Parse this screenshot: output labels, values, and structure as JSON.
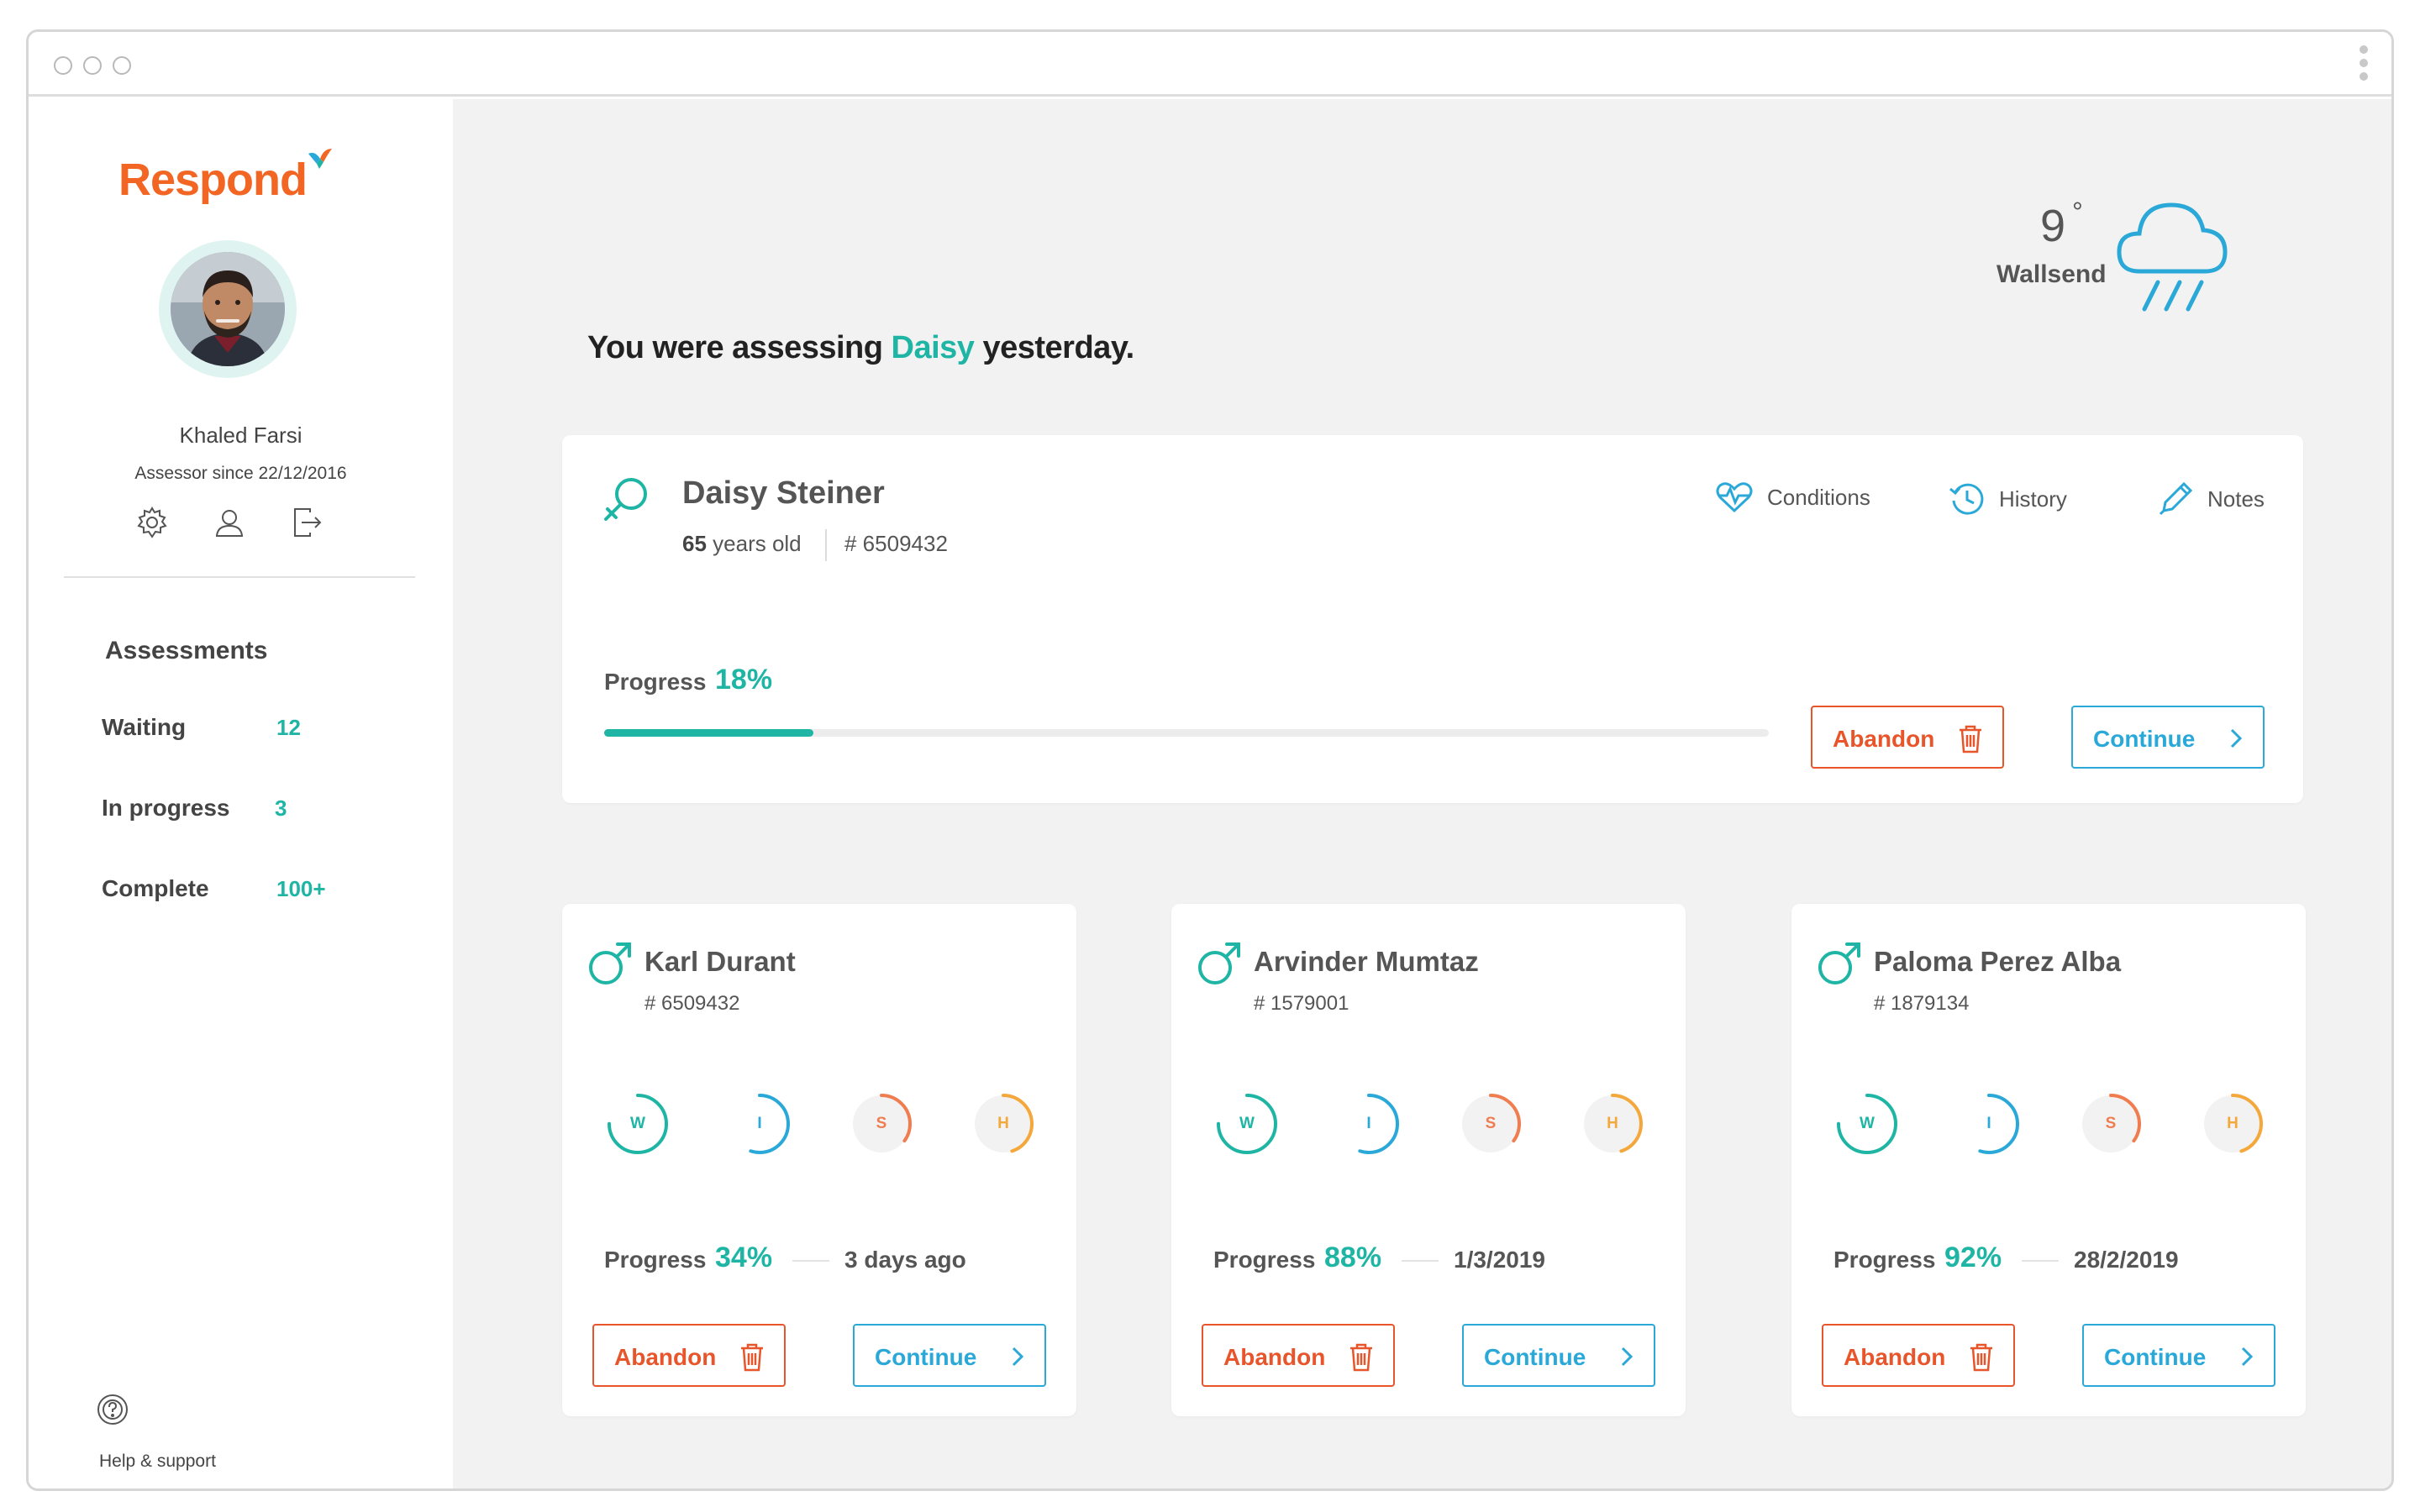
{
  "app": {
    "logo": "Respond",
    "brand_color": "#f26522",
    "accent": "#1fb5a5",
    "link": "#2aa8d8",
    "danger": "#e8552b"
  },
  "user": {
    "name": "Khaled Farsi",
    "since": "Assessor since 22/12/2016"
  },
  "sidebar": {
    "icons": [
      "settings-icon",
      "profile-icon",
      "logout-icon"
    ],
    "assessments_title": "Assessments",
    "items": [
      {
        "label": "Waiting",
        "count": "12"
      },
      {
        "label": "In progress",
        "count": "3"
      },
      {
        "label": "Complete",
        "count": "100+"
      }
    ],
    "help_label": "Help & support"
  },
  "greeting": {
    "prefix": "You were assessing ",
    "name": "Daisy",
    "suffix": " yesterday."
  },
  "weather": {
    "temp": "9",
    "degree": "°",
    "city": "Wallsend",
    "condition_icon": "rain-cloud-icon"
  },
  "current": {
    "name": "Daisy Steiner",
    "age_num": "65",
    "age_suffix": " years old",
    "id": "# 6509432",
    "tools": {
      "conditions": "Conditions",
      "history": "History",
      "notes": "Notes"
    },
    "progress_label": "Progress",
    "progress": "18%",
    "progress_fraction": 0.18,
    "abandon": "Abandon",
    "continue": "Continue"
  },
  "cards": [
    {
      "name": "Karl Durant",
      "id": "# 6509432",
      "progress_label": "Progress",
      "progress": "34%",
      "when": "3 days ago",
      "gauges": [
        "W",
        "I",
        "S",
        "H"
      ],
      "abandon": "Abandon",
      "continue": "Continue"
    },
    {
      "name": "Arvinder Mumtaz",
      "id": "# 1579001",
      "progress_label": "Progress",
      "progress": "88%",
      "when": "1/3/2019",
      "gauges": [
        "W",
        "I",
        "S",
        "H"
      ],
      "abandon": "Abandon",
      "continue": "Continue"
    },
    {
      "name": "Paloma Perez Alba",
      "id": "# 1879134",
      "progress_label": "Progress",
      "progress": "92%",
      "when": "28/2/2019",
      "gauges": [
        "W",
        "I",
        "S",
        "H"
      ],
      "abandon": "Abandon",
      "continue": "Continue"
    }
  ],
  "gauge_colors": {
    "W": "#1fb5a5",
    "I": "#2aa8d8",
    "S": "#ef7d4f",
    "H": "#f4a83c"
  }
}
